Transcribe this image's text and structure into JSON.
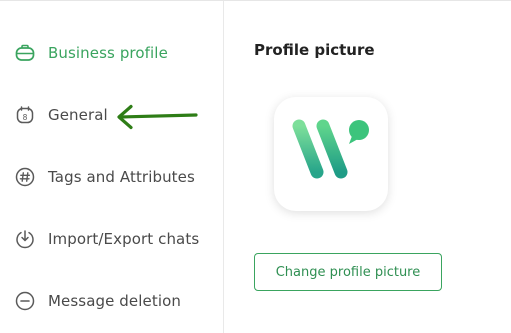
{
  "sidebar": {
    "items": [
      {
        "label": "Business profile",
        "icon": "briefcase-icon",
        "active": true
      },
      {
        "label": "General",
        "icon": "calendar-icon",
        "active": false
      },
      {
        "label": "Tags and Attributes",
        "icon": "hashtag-icon",
        "active": false
      },
      {
        "label": "Import/Export chats",
        "icon": "import-export-icon",
        "active": false
      },
      {
        "label": "Message deletion",
        "icon": "minus-circle-icon",
        "active": false
      }
    ],
    "general_icon_text": "8"
  },
  "annotation": {
    "icon": "arrow-left-icon",
    "color": "#2e7d16"
  },
  "profile": {
    "title": "Profile picture",
    "logo_icon": "wati-logo-icon",
    "change_button_label": "Change profile picture"
  },
  "colors": {
    "accent": "#3aa45f",
    "text": "#4a4a4a",
    "heading": "#222222"
  }
}
